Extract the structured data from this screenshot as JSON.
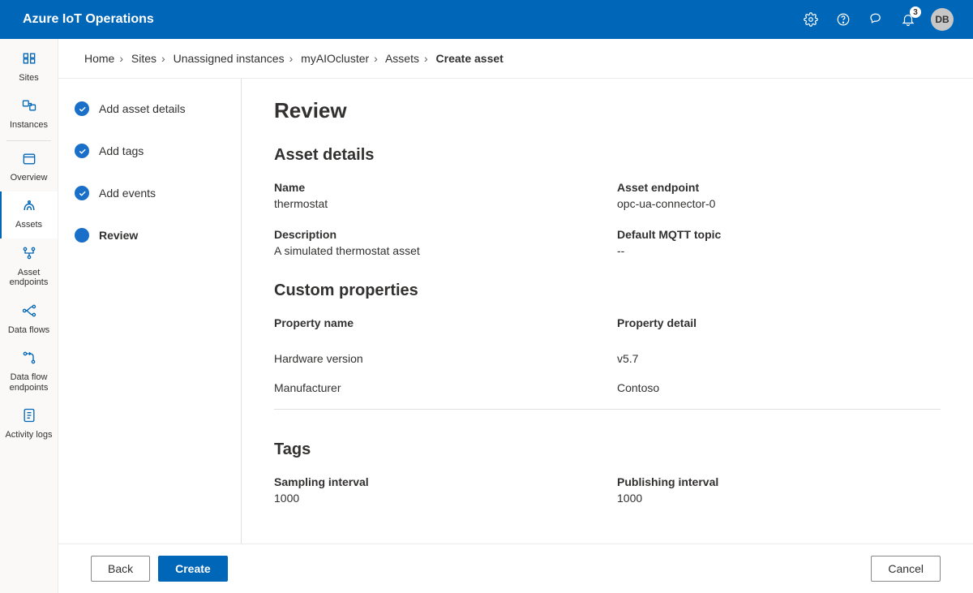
{
  "header": {
    "brand": "Azure IoT Operations",
    "notification_count": "3",
    "avatar_initials": "DB"
  },
  "rail": {
    "items": [
      {
        "id": "sites",
        "label": "Sites"
      },
      {
        "id": "instances",
        "label": "Instances"
      },
      {
        "id": "overview",
        "label": "Overview"
      },
      {
        "id": "assets",
        "label": "Assets",
        "active": true
      },
      {
        "id": "asset-endpoints",
        "label": "Asset endpoints"
      },
      {
        "id": "data-flows",
        "label": "Data flows"
      },
      {
        "id": "dataflow-endpoints",
        "label": "Data flow endpoints"
      },
      {
        "id": "activity-logs",
        "label": "Activity logs"
      }
    ]
  },
  "breadcrumbs": {
    "items": [
      {
        "label": "Home"
      },
      {
        "label": "Sites"
      },
      {
        "label": "Unassigned instances"
      },
      {
        "label": "myAIOcluster"
      },
      {
        "label": "Assets"
      },
      {
        "label": "Create asset",
        "current": true
      }
    ]
  },
  "stepper": {
    "steps": [
      {
        "label": "Add asset details",
        "state": "completed"
      },
      {
        "label": "Add tags",
        "state": "completed"
      },
      {
        "label": "Add events",
        "state": "completed"
      },
      {
        "label": "Review",
        "state": "current"
      }
    ]
  },
  "review": {
    "title": "Review",
    "asset_details": {
      "heading": "Asset details",
      "name_label": "Name",
      "name_value": "thermostat",
      "endpoint_label": "Asset endpoint",
      "endpoint_value": "opc-ua-connector-0",
      "description_label": "Description",
      "description_value": "A simulated thermostat asset",
      "mqtt_label": "Default MQTT topic",
      "mqtt_value": "--"
    },
    "custom_properties": {
      "heading": "Custom properties",
      "col1": "Property name",
      "col2": "Property detail",
      "rows": [
        {
          "name": "Hardware version",
          "detail": "v5.7"
        },
        {
          "name": "Manufacturer",
          "detail": "Contoso"
        }
      ]
    },
    "tags": {
      "heading": "Tags",
      "sampling_label": "Sampling interval",
      "sampling_value": "1000",
      "publishing_label": "Publishing interval",
      "publishing_value": "1000"
    }
  },
  "footer": {
    "back": "Back",
    "create": "Create",
    "cancel": "Cancel"
  }
}
